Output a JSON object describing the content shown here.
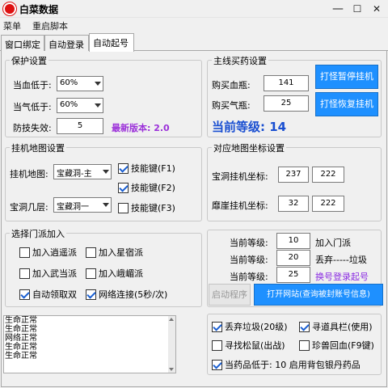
{
  "window": {
    "title": "白菜数据",
    "minimize": "—",
    "maximize": "☐",
    "close": "✕"
  },
  "menu": [
    "菜单",
    "重启脚本"
  ],
  "tabs": [
    "窗口绑定",
    "自动登录",
    "自动起号"
  ],
  "protect": {
    "title": "保护设置",
    "hp_label": "当血低于:",
    "hp_value": "60%",
    "mp_label": "当气低于:",
    "mp_value": "60%",
    "fail_label": "防技失效:",
    "fail_value": "5",
    "version": "最新版本: 2.0"
  },
  "buy": {
    "title": "主线买药设置",
    "hp_label": "购买血瓶:",
    "hp_value": "141",
    "mp_label": "购买气瓶:",
    "mp_value": "25",
    "pause_btn": "打怪暂停挂机",
    "resume_btn": "打怪恢复挂机",
    "level_text": "当前等级: 14"
  },
  "map": {
    "title": "挂机地图设置",
    "map_label": "挂机地图:",
    "map_value": "宝藏洞-主",
    "floor_label": "宝洞几层:",
    "floor_value": "宝藏洞一",
    "skills": [
      {
        "label": "技能键(F1)",
        "checked": true
      },
      {
        "label": "技能键(F2)",
        "checked": true
      },
      {
        "label": "技能键(F3)",
        "checked": false
      }
    ]
  },
  "coords": {
    "title": "对应地图坐标设置",
    "baodong_label": "宝洞挂机坐标:",
    "baodong_x": "237",
    "baodong_y": "222",
    "moya_label": "靡崖挂机坐标:",
    "moya_x": "32",
    "moya_y": "222"
  },
  "sect": {
    "title": "选择门派加入",
    "options": [
      {
        "label": "加入逍遥派",
        "checked": false
      },
      {
        "label": "加入星宿派",
        "checked": false
      },
      {
        "label": "加入武当派",
        "checked": false
      },
      {
        "label": "加入峨嵋派",
        "checked": false
      },
      {
        "label": "自动领取双",
        "checked": true
      },
      {
        "label": "网络连接(5秒/次)",
        "checked": true
      }
    ]
  },
  "levels": {
    "rows": [
      {
        "label": "当前等级:",
        "value": "10",
        "note": "加入门派"
      },
      {
        "label": "当前等级:",
        "value": "20",
        "note": "丢弃-----垃圾"
      },
      {
        "label": "当前等级:",
        "value": "25",
        "note": "换号登录起号"
      }
    ],
    "start_btn": "启动程序",
    "open_site_btn": "打开网站(查询被封账号信息)"
  },
  "log": {
    "lines": [
      "生命正常",
      "生命正常",
      "网络正常",
      "生命正常",
      "生命正常"
    ]
  },
  "misc": {
    "options": [
      {
        "label": "丢弃垃圾(20级)",
        "checked": true
      },
      {
        "label": "寻道具栏(使用)",
        "checked": true
      },
      {
        "label": "寻找松鼠(出战)",
        "checked": false
      },
      {
        "label": "珍兽回血(F9键)",
        "checked": false
      },
      {
        "label": "当药品低于: 10 启用背包银丹药品",
        "checked": true
      }
    ]
  },
  "colors": {
    "accent": "#1e90ff",
    "version": "#9b30d9",
    "level": "#1a4fd1",
    "purple_note": "#8a2be2"
  }
}
